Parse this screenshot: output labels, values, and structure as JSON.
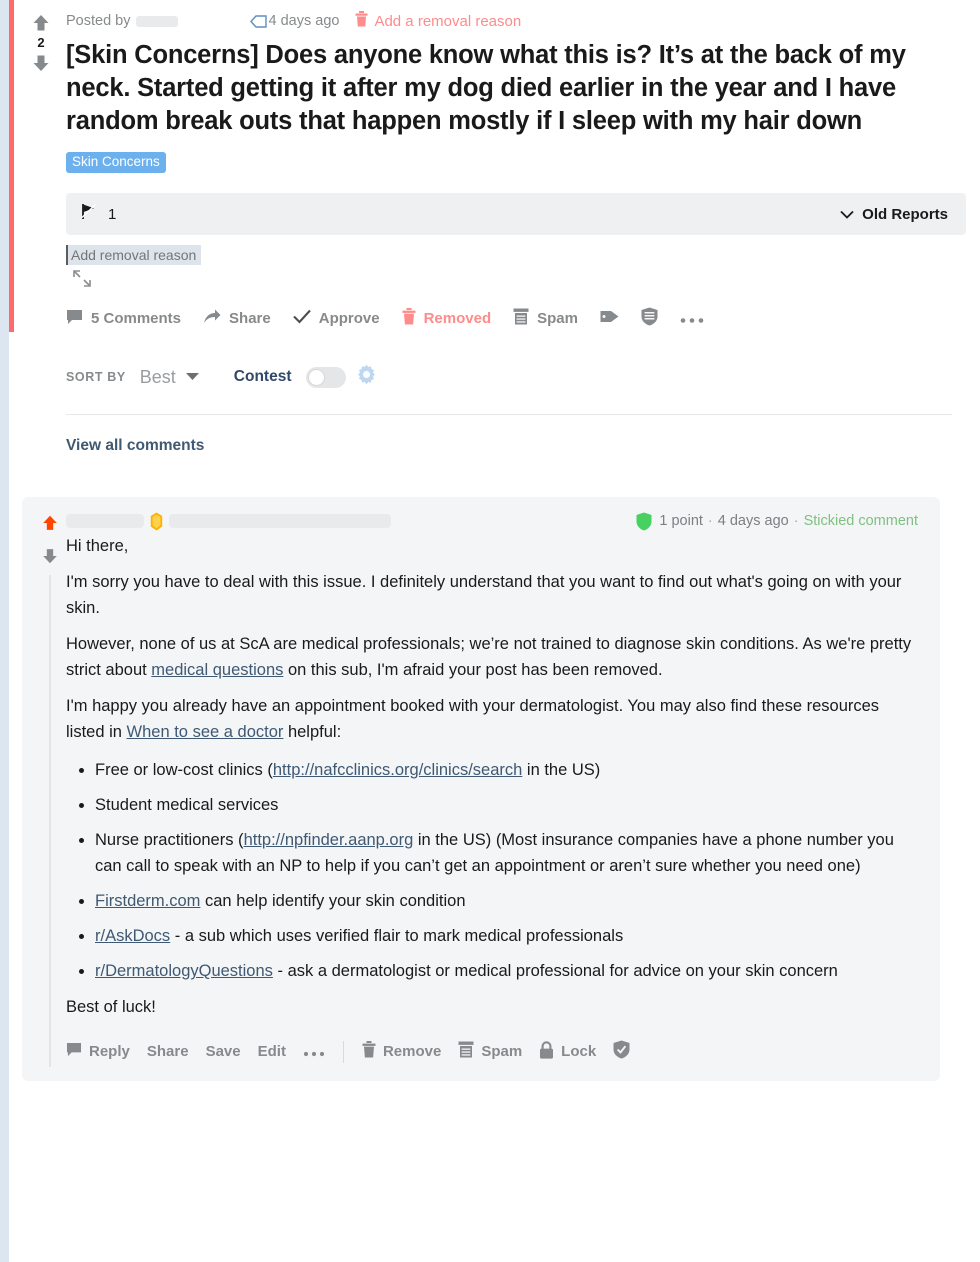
{
  "post": {
    "vote_count": "2",
    "posted_by_label": "Posted by",
    "author_redacted": true,
    "timestamp": "4 days ago",
    "removal_reason_link": "Add a removal reason",
    "title": "[Skin Concerns] Does anyone know what this is? It’s at the back of my neck. Started getting it after my dog died earlier in the year and I have random break outs that happen mostly if I sleep with my hair down",
    "flair": "Skin Concerns",
    "flair_color": "#6cb0ee",
    "reports": {
      "count": "1",
      "old_reports_label": "Old Reports"
    },
    "removal_input_placeholder": "Add removal reason",
    "removal_input_value": "",
    "actions": [
      {
        "label": "5 Comments",
        "icon": "comment-icon",
        "state": "default"
      },
      {
        "label": "Share",
        "icon": "share-icon",
        "state": "default"
      },
      {
        "label": "Approve",
        "icon": "check-icon",
        "state": "default"
      },
      {
        "label": "Removed",
        "icon": "trash-icon",
        "state": "removed"
      },
      {
        "label": "Spam",
        "icon": "spam-icon",
        "state": "default"
      }
    ],
    "icon_actions": [
      {
        "icon": "tag-icon"
      },
      {
        "icon": "shield-mod-icon"
      },
      {
        "icon": "ellipsis-icon"
      }
    ]
  },
  "sort": {
    "label": "SORT BY",
    "value": "Best",
    "contest_label": "Contest",
    "contest_enabled": false,
    "gear_icon": "gear-icon",
    "gear_color": "#bcd7ef"
  },
  "view_all_comments": "View all comments",
  "comment": {
    "vote_state": "upvoted",
    "upvote_color": "#ff4500",
    "author_redacted": true,
    "badge_icon": "gold-award-icon",
    "mod_shield_icon": "shield-icon",
    "mod_shield_color": "#46d160",
    "points": "1 point",
    "timestamp": "4 days ago",
    "sticky_label": "Stickied comment",
    "sticky_color": "#80c080",
    "paragraphs": [
      "Hi there,",
      "I'm sorry you have to deal with this issue. I definitely understand that you want to find out what's going on with your skin."
    ],
    "para_however": {
      "before": "However, none of us at ScA are medical professionals; we’re not trained to diagnose skin conditions. As we're pretty strict about ",
      "link": "medical questions",
      "after": " on this sub, I'm afraid your post has been removed."
    },
    "para_happy": {
      "before": "I'm happy you already have an appointment booked with your dermatologist. You may also find these resources listed in ",
      "link": "When to see a doctor",
      "after": " helpful:"
    },
    "list": [
      {
        "before": "Free or low-cost clinics (",
        "link": "http://nafcclinics.org/clinics/search",
        "after": " in the US)"
      },
      {
        "before": "Student medical services",
        "link": "",
        "after": ""
      },
      {
        "before": "Nurse practitioners (",
        "link": "http://npfinder.aanp.org",
        "after": " in the US) (Most insurance companies have a phone number you can call to speak with an NP to help if you can’t get an appointment or aren’t sure whether you need one)"
      },
      {
        "before": "",
        "link": "Firstderm.com",
        "after": " can help identify your skin condition"
      },
      {
        "before": "",
        "link": "r/AskDocs",
        "after": " - a sub which uses verified flair to mark medical professionals"
      },
      {
        "before": "",
        "link": "r/DermatologyQuestions",
        "after": " - ask a dermatologist or medical professional for advice on your skin concern"
      }
    ],
    "closing": "Best of luck!",
    "actions": [
      {
        "label": "Reply",
        "icon": "comment-icon"
      },
      {
        "label": "Share",
        "icon": ""
      },
      {
        "label": "Save",
        "icon": ""
      },
      {
        "label": "Edit",
        "icon": ""
      },
      {
        "label": "•••",
        "icon": "ellipsis-icon"
      }
    ],
    "mod_actions": [
      {
        "label": "Remove",
        "icon": "trash-icon"
      },
      {
        "label": "Spam",
        "icon": "spam-icon"
      },
      {
        "label": "Lock",
        "icon": "lock-icon"
      },
      {
        "label": "",
        "icon": "shield-mod-icon"
      }
    ]
  }
}
